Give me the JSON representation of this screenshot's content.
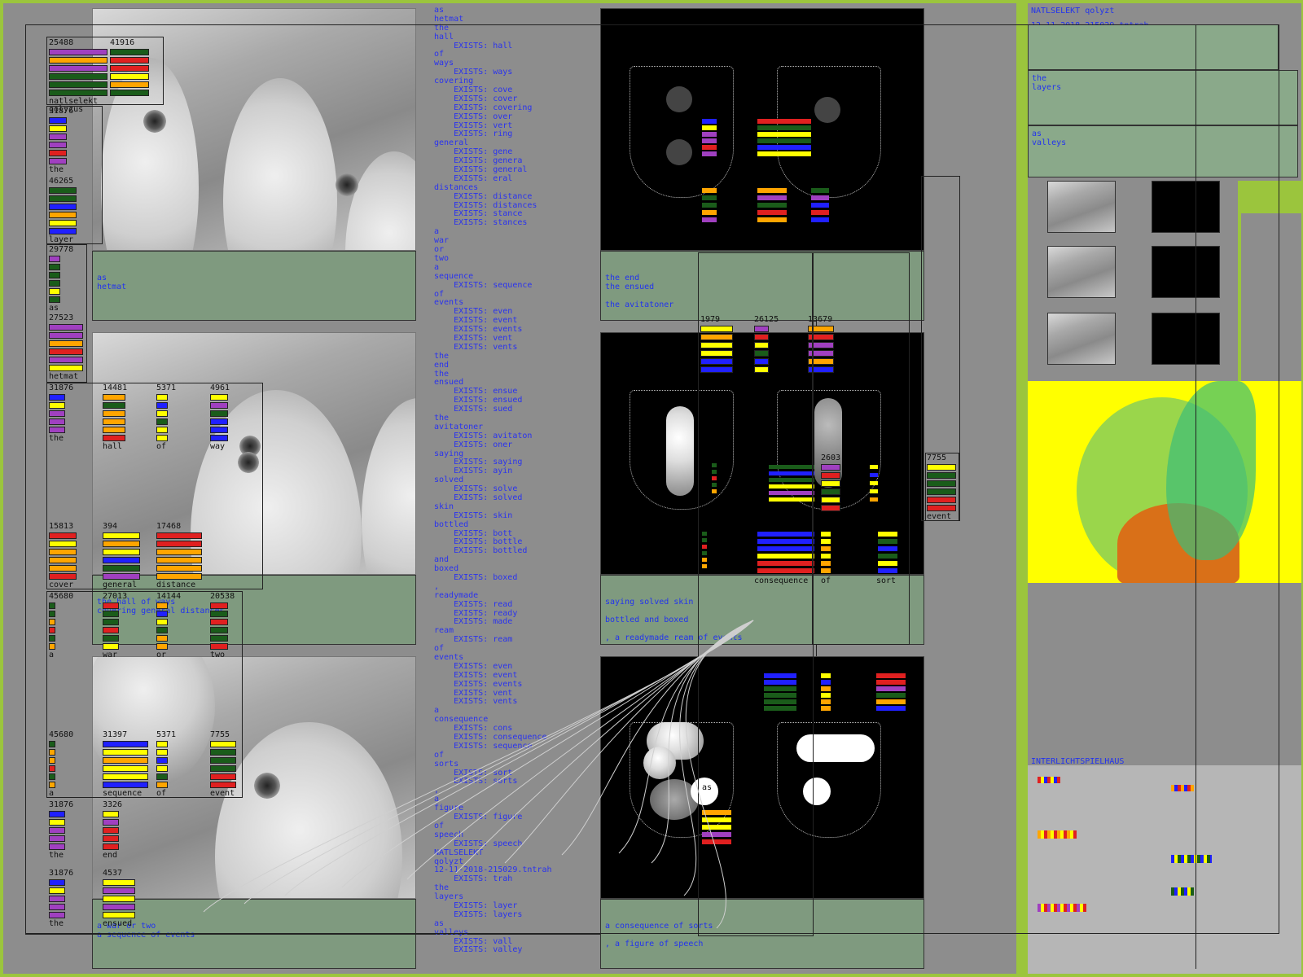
{
  "app": {
    "title": "NATLSELEKT qolyzt",
    "stamp": "12-11-2018-215029.tntrah"
  },
  "left_captions": [
    {
      "lines": [
        "as",
        "hetmat"
      ]
    },
    {
      "lines": [
        "the hall of ways",
        "covering general distances"
      ]
    },
    {
      "lines": [
        "a war or two",
        "a sequence of events"
      ]
    }
  ],
  "left_meters": [
    {
      "num": "25488",
      "label": "natlselekt qolyzus"
    },
    {
      "num": "41916",
      "label": ""
    },
    {
      "num": "31876",
      "label": "the"
    },
    {
      "num": "46265",
      "label": "layer"
    },
    {
      "num": "29778",
      "label": "as"
    },
    {
      "num": "27523",
      "label": "hetmat"
    },
    {
      "num": "31876",
      "label": "the"
    },
    {
      "num": "14481",
      "label": "hall"
    },
    {
      "num": "5371",
      "label": "of"
    },
    {
      "num": "4961",
      "label": "way"
    },
    {
      "num": "15813",
      "label": "cover"
    },
    {
      "num": "394",
      "label": "general"
    },
    {
      "num": "17468",
      "label": "distance"
    },
    {
      "num": "45680",
      "label": "a"
    },
    {
      "num": "27013",
      "label": "war"
    },
    {
      "num": "14144",
      "label": "or"
    },
    {
      "num": "20538",
      "label": "two"
    },
    {
      "num": "45680",
      "label": "a"
    },
    {
      "num": "31397",
      "label": "sequence"
    },
    {
      "num": "5371",
      "label": "of"
    },
    {
      "num": "7755",
      "label": "event"
    },
    {
      "num": "31876",
      "label": "the"
    },
    {
      "num": "3326",
      "label": "end"
    },
    {
      "num": "31876",
      "label": "the"
    },
    {
      "num": "4537",
      "label": "ensued"
    }
  ],
  "word_list": [
    "as",
    "hetmat",
    "the",
    "hall",
    "    EXISTS: hall",
    "of",
    "ways",
    "    EXISTS: ways",
    "covering",
    "    EXISTS: cove",
    "    EXISTS: cover",
    "    EXISTS: covering",
    "    EXISTS: over",
    "    EXISTS: vert",
    "    EXISTS: ring",
    "general",
    "    EXISTS: gene",
    "    EXISTS: genera",
    "    EXISTS: general",
    "    EXISTS: eral",
    "distances",
    "    EXISTS: distance",
    "    EXISTS: distances",
    "    EXISTS: stance",
    "    EXISTS: stances",
    "a",
    "war",
    "or",
    "two",
    "a",
    "sequence",
    "    EXISTS: sequence",
    "of",
    "events",
    "    EXISTS: even",
    "    EXISTS: event",
    "    EXISTS: events",
    "    EXISTS: vent",
    "    EXISTS: vents",
    "the",
    "end",
    "the",
    "ensued",
    "    EXISTS: ensue",
    "    EXISTS: ensued",
    "    EXISTS: sued",
    "the",
    "avitatoner",
    "    EXISTS: avitaton",
    "    EXISTS: oner",
    "saying",
    "    EXISTS: saying",
    "    EXISTS: ayin",
    "solved",
    "    EXISTS: solve",
    "    EXISTS: solved",
    "skin",
    "    EXISTS: skin",
    "bottled",
    "    EXISTS: bott",
    "    EXISTS: bottle",
    "    EXISTS: bottled",
    "and",
    "boxed",
    "    EXISTS: boxed",
    ",",
    "readymade",
    "    EXISTS: read",
    "    EXISTS: ready",
    "    EXISTS: made",
    "ream",
    "    EXISTS: ream",
    "of",
    "events",
    "    EXISTS: even",
    "    EXISTS: event",
    "    EXISTS: events",
    "    EXISTS: vent",
    "    EXISTS: vents",
    "a",
    "consequence",
    "    EXISTS: cons",
    "    EXISTS: consequence",
    "    EXISTS: sequence",
    "of",
    "sorts",
    "    EXISTS: sort",
    "    EXISTS: sorts",
    ",",
    "a",
    "figure",
    "    EXISTS: figure",
    "of",
    "speech",
    "    EXISTS: speech",
    "NATLSELEKT",
    "qolyzt",
    "12-11-2018-215029.tntrah",
    "    EXISTS: trah",
    "the",
    "layers",
    "    EXISTS: layer",
    "    EXISTS: layers",
    "as",
    "valleys",
    "    EXISTS: vall",
    "    EXISTS: valley"
  ],
  "mid_captions": [
    {
      "lines": [
        "the end",
        "the ensued",
        "",
        "the avitatoner"
      ]
    },
    {
      "lines": [
        "saying solved skin",
        "",
        "bottled and boxed",
        "",
        ", a readymade ream of events"
      ]
    },
    {
      "lines": [
        "a consequence of sorts",
        "",
        ", a figure of speech"
      ]
    }
  ],
  "mid_meters": [
    {
      "num": "1979",
      "label": ""
    },
    {
      "num": "26125",
      "label": ""
    },
    {
      "num": "13679",
      "label": ""
    },
    {
      "num": "2603",
      "label": ""
    },
    {
      "num": "7755",
      "label": "event"
    }
  ],
  "mid_labels": [
    "consequence",
    "of",
    "sort",
    "as"
  ],
  "right": {
    "header": "NATLSELEKT qolyzt",
    "stamp": "12-11-2018-215029.tntrah",
    "section1": [
      "the",
      "layers"
    ],
    "section2": [
      "as",
      "valleys"
    ],
    "lower_title": "INTERLICHTSPIELHAUS"
  },
  "colors": {
    "background": "#9bc53d",
    "stage": "#8d8d8d",
    "caption": "#7f9a7f",
    "text_blue": "#2233ee",
    "yellow": "#ffff00"
  }
}
